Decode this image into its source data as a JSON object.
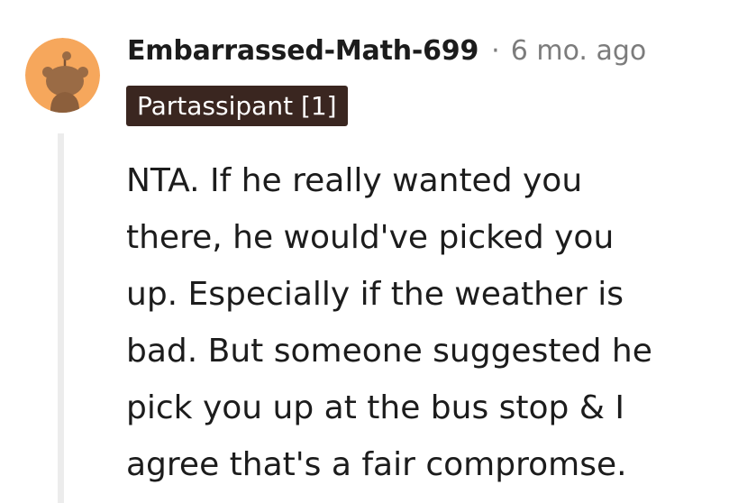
{
  "comment": {
    "username": "Embarrassed-Math-699",
    "separator": "·",
    "timestamp": "6 mo. ago",
    "flair": "Partassipant [1]",
    "body_lines": [
      "NTA. If he really wanted you",
      "there, he would've picked you",
      "up. Especially if the weather is",
      "bad. But someone suggested he",
      "pick you up at the bus stop & I",
      "agree that's a fair compromse."
    ]
  },
  "colors": {
    "avatar_bg": "#f6a75c",
    "avatar_figure": "#9a6b45",
    "flair_bg": "#3a2620",
    "meta_text": "#7c7c7c",
    "thread_line": "#ececec"
  },
  "icons": {
    "avatar": "snoo-avatar-icon"
  }
}
